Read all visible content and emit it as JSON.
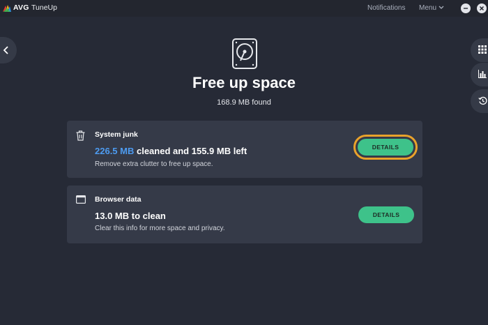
{
  "titlebar": {
    "brand": "AVG",
    "app_name": "TuneUp",
    "notifications": "Notifications",
    "menu": "Menu"
  },
  "header": {
    "title": "Free up space",
    "found": "168.9 MB found"
  },
  "cards": [
    {
      "title": "System junk",
      "highlight": "226.5 MB",
      "main_rest": " cleaned and 155.9 MB left",
      "subtitle": "Remove extra clutter to free up space.",
      "button": "DETAILS"
    },
    {
      "title": "Browser data",
      "main": "13.0 MB to clean",
      "subtitle": "Clear this info for more space and privacy.",
      "button": "DETAILS"
    }
  ],
  "icons": {
    "hdd": "hard-drive-icon",
    "trash": "trash-icon",
    "browser": "browser-window-icon",
    "back": "chevron-left-icon",
    "apps": "grid-icon",
    "stats": "bar-chart-icon",
    "history": "history-icon"
  },
  "colors": {
    "accent_green": "#3ec28a",
    "highlight_blue": "#4d9bf0",
    "focus_ring": "#e9a22b",
    "card_bg": "#353a48",
    "page_bg": "#262a36"
  }
}
